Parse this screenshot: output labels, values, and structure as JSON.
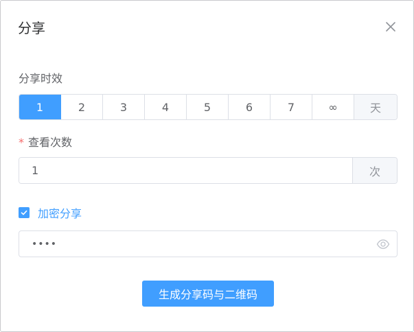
{
  "dialog": {
    "title": "分享"
  },
  "expiry": {
    "label": "分享时效",
    "options": [
      "1",
      "2",
      "3",
      "4",
      "5",
      "6",
      "7",
      "∞"
    ],
    "selected": "1",
    "unit": "天"
  },
  "view_count": {
    "required_mark": "*",
    "label": "查看次数",
    "value": "1",
    "unit": "次"
  },
  "encrypt": {
    "checked": true,
    "label": "加密分享",
    "password_masked": "••••"
  },
  "actions": {
    "generate_label": "生成分享码与二维码"
  },
  "colors": {
    "primary": "#409eff",
    "required": "#f56c6c",
    "border": "#dcdfe6",
    "addon_bg": "#f5f7fa"
  },
  "icons": {
    "close": "close-icon",
    "check": "check-icon",
    "eye": "eye-icon"
  }
}
